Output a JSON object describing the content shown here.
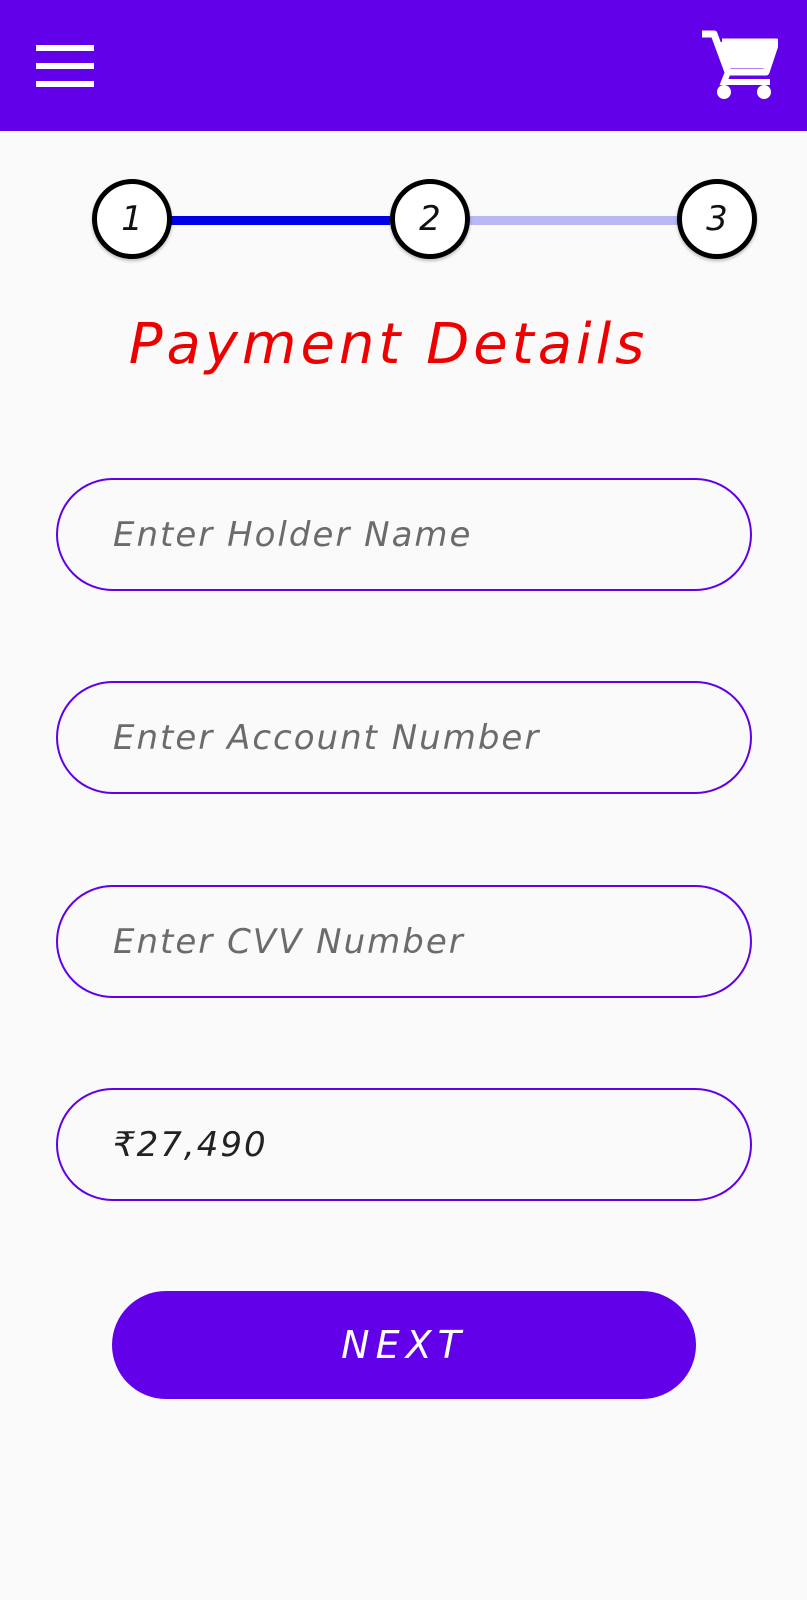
{
  "app_bar": {
    "menu_icon": "hamburger-menu-icon",
    "cart_icon": "shopping-cart-icon",
    "color": "#6200ea"
  },
  "stepper": {
    "current_step": 2,
    "steps": [
      "1",
      "2",
      "3"
    ],
    "completed_color": "#0000e6",
    "pending_color": "#b9b7f5"
  },
  "title": "Payment Details",
  "form": {
    "holder_name": {
      "placeholder": "Enter Holder Name",
      "value": ""
    },
    "account_number": {
      "placeholder": "Enter Account Number",
      "value": ""
    },
    "cvv": {
      "placeholder": "Enter CVV Number",
      "value": ""
    },
    "amount": {
      "placeholder": "",
      "value": "₹27,490"
    }
  },
  "next_label": "NEXT",
  "accent_color": "#6200ea",
  "title_color": "#ee0000"
}
